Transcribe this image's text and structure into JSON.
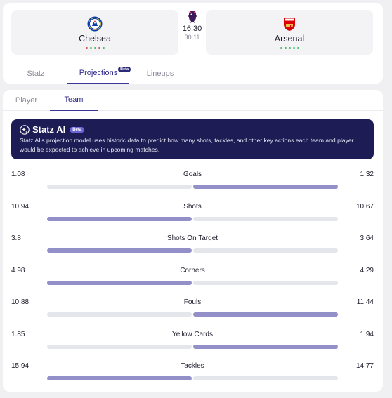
{
  "match": {
    "home_team": "Chelsea",
    "away_team": "Arsenal",
    "kickoff_time": "16:30",
    "kickoff_date": "30.11",
    "home_form": [
      "#e24a4a",
      "#3bbf6a",
      "#3bbf6a",
      "#e24a4a",
      "#3bbf6a"
    ],
    "away_form": [
      "#3bbf6a",
      "#3bbf6a",
      "#3bbf6a",
      "#3bbf6a",
      "#3bbf6a"
    ]
  },
  "main_tabs": [
    {
      "label": "Statz"
    },
    {
      "label": "Projections",
      "badge": "Beta",
      "active": true
    },
    {
      "label": "Lineups"
    }
  ],
  "sub_tabs": [
    {
      "label": "Player"
    },
    {
      "label": "Team",
      "active": true
    }
  ],
  "ai_banner": {
    "title": "Statz AI",
    "badge": "Beta",
    "text": "Statz AI's projection model uses historic data to predict how many shots, tackles, and other key actions each team and player would be expected to achieve in upcoming matches."
  },
  "colors": {
    "accent": "#2e2a8a",
    "banner_bg": "#1d1c55",
    "bar_fill": "#938fc8",
    "bar_track": "#e5e5ec"
  },
  "stats": [
    {
      "label": "Goals",
      "home": "1.08",
      "away": "1.32",
      "leader": "away"
    },
    {
      "label": "Shots",
      "home": "10.94",
      "away": "10.67",
      "leader": "home"
    },
    {
      "label": "Shots On Target",
      "home": "3.8",
      "away": "3.64",
      "leader": "home"
    },
    {
      "label": "Corners",
      "home": "4.98",
      "away": "4.29",
      "leader": "home"
    },
    {
      "label": "Fouls",
      "home": "10.88",
      "away": "11.44",
      "leader": "away"
    },
    {
      "label": "Yellow Cards",
      "home": "1.85",
      "away": "1.94",
      "leader": "away"
    },
    {
      "label": "Tackles",
      "home": "15.94",
      "away": "14.77",
      "leader": "home"
    }
  ]
}
